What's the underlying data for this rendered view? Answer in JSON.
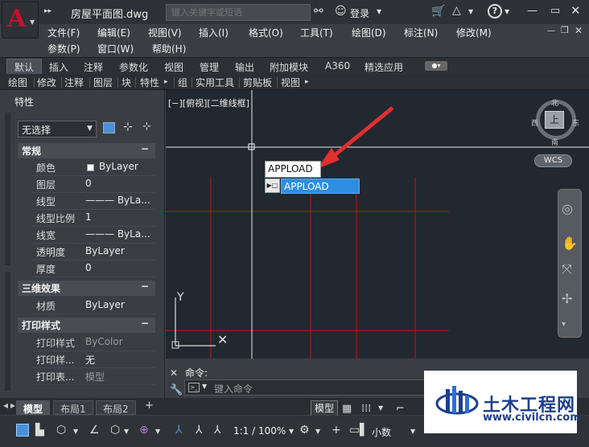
{
  "titlebar": {
    "app_letter": "A",
    "doc_title": "房屋平面图.dwg",
    "search_placeholder": "键入关键字或短语",
    "login": "登录"
  },
  "menus": {
    "row1": [
      "文件(F)",
      "编辑(E)",
      "视图(V)",
      "插入(I)",
      "格式(O)",
      "工具(T)",
      "绘图(D)",
      "标注(N)",
      "修改(M)"
    ],
    "row2": [
      "参数(P)",
      "窗口(W)",
      "帮助(H)"
    ]
  },
  "ribbon_tabs": [
    "默认",
    "插入",
    "注释",
    "参数化",
    "视图",
    "管理",
    "输出",
    "附加模块",
    "A360",
    "精选应用"
  ],
  "panels": [
    "绘图",
    "修改",
    "注释",
    "图层",
    "块",
    "特性",
    "组",
    "实用工具",
    "剪贴板",
    "视图"
  ],
  "properties": {
    "title": "特性",
    "selection": "无选择",
    "sections": [
      {
        "name": "常规",
        "rows": [
          [
            "颜色",
            "ByLayer"
          ],
          [
            "图层",
            "0"
          ],
          [
            "线型",
            "——— ByLa..."
          ],
          [
            "线型比例",
            "1"
          ],
          [
            "线宽",
            "——— ByLa..."
          ],
          [
            "透明度",
            "ByLayer"
          ],
          [
            "厚度",
            "0"
          ]
        ]
      },
      {
        "name": "三维效果",
        "rows": [
          [
            "材质",
            "ByLayer"
          ]
        ]
      },
      {
        "name": "打印样式",
        "rows": [
          [
            "打印样式",
            "ByColor"
          ],
          [
            "打印样...",
            "无"
          ],
          [
            "打印表...",
            "模型"
          ]
        ]
      }
    ]
  },
  "viewport": {
    "label": "[−][俯视][二维线框]"
  },
  "viewcube": {
    "north": "北",
    "south": "南",
    "west": "西",
    "east": "东",
    "top": "上",
    "wcs": "WCS"
  },
  "autocomplete": {
    "typed": "APPLOAD",
    "suggestion": "APPLOAD"
  },
  "command": {
    "label": "命令:",
    "placeholder": "键入命令"
  },
  "layout_tabs": [
    "模型",
    "布局1",
    "布局2"
  ],
  "status": {
    "model": "模型",
    "scale": "1:1 / 100%",
    "annot_scale": "小数"
  },
  "watermark": {
    "name": "土木工程网",
    "url": "www.civilcn.com"
  },
  "colors": {
    "grid_line": "#cc1111",
    "canvas": "#212830",
    "highlight": "#2f8ee0",
    "arrow": "#e03030"
  }
}
